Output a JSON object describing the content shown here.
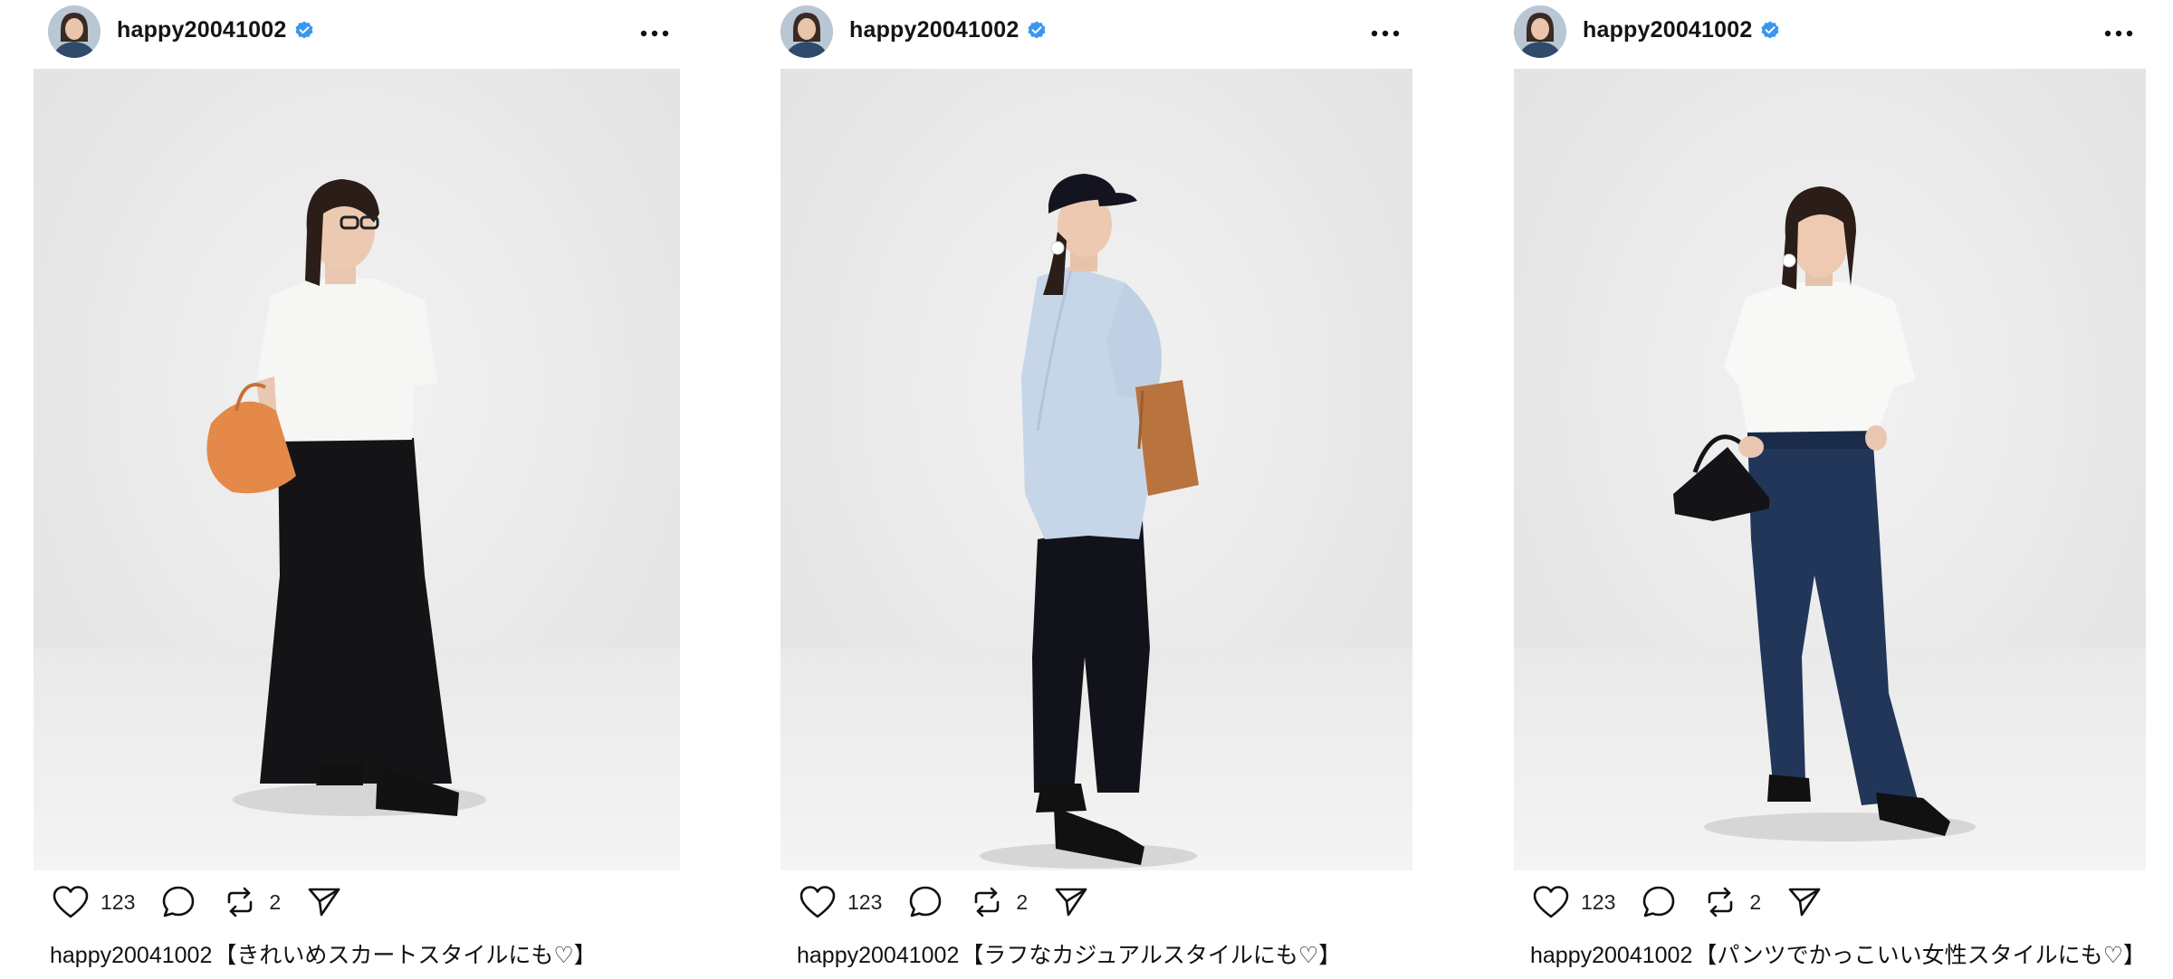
{
  "posts": [
    {
      "username": "happy20041002",
      "likes": "123",
      "reposts": "2",
      "caption_user": "happy20041002",
      "caption_text": "【きれいめスカートスタイルにも♡】",
      "icons": [
        "heart-icon",
        "comment-icon",
        "repost-icon",
        "share-icon",
        "verified-icon",
        "more-icon"
      ]
    },
    {
      "username": "happy20041002",
      "likes": "123",
      "reposts": "2",
      "caption_user": "happy20041002",
      "caption_text": "【ラフなカジュアルスタイルにも♡】",
      "icons": [
        "heart-icon",
        "comment-icon",
        "repost-icon",
        "share-icon",
        "verified-icon",
        "more-icon"
      ]
    },
    {
      "username": "happy20041002",
      "likes": "123",
      "reposts": "2",
      "caption_user": "happy20041002",
      "caption_text": "【パンツでかっこいい女性スタイルにも♡】",
      "icons": [
        "heart-icon",
        "comment-icon",
        "repost-icon",
        "share-icon",
        "verified-icon",
        "more-icon"
      ]
    }
  ],
  "colors": {
    "verified": "#3897f0",
    "background": "#ffffff",
    "photo_backdrop": "#ebebeb"
  }
}
